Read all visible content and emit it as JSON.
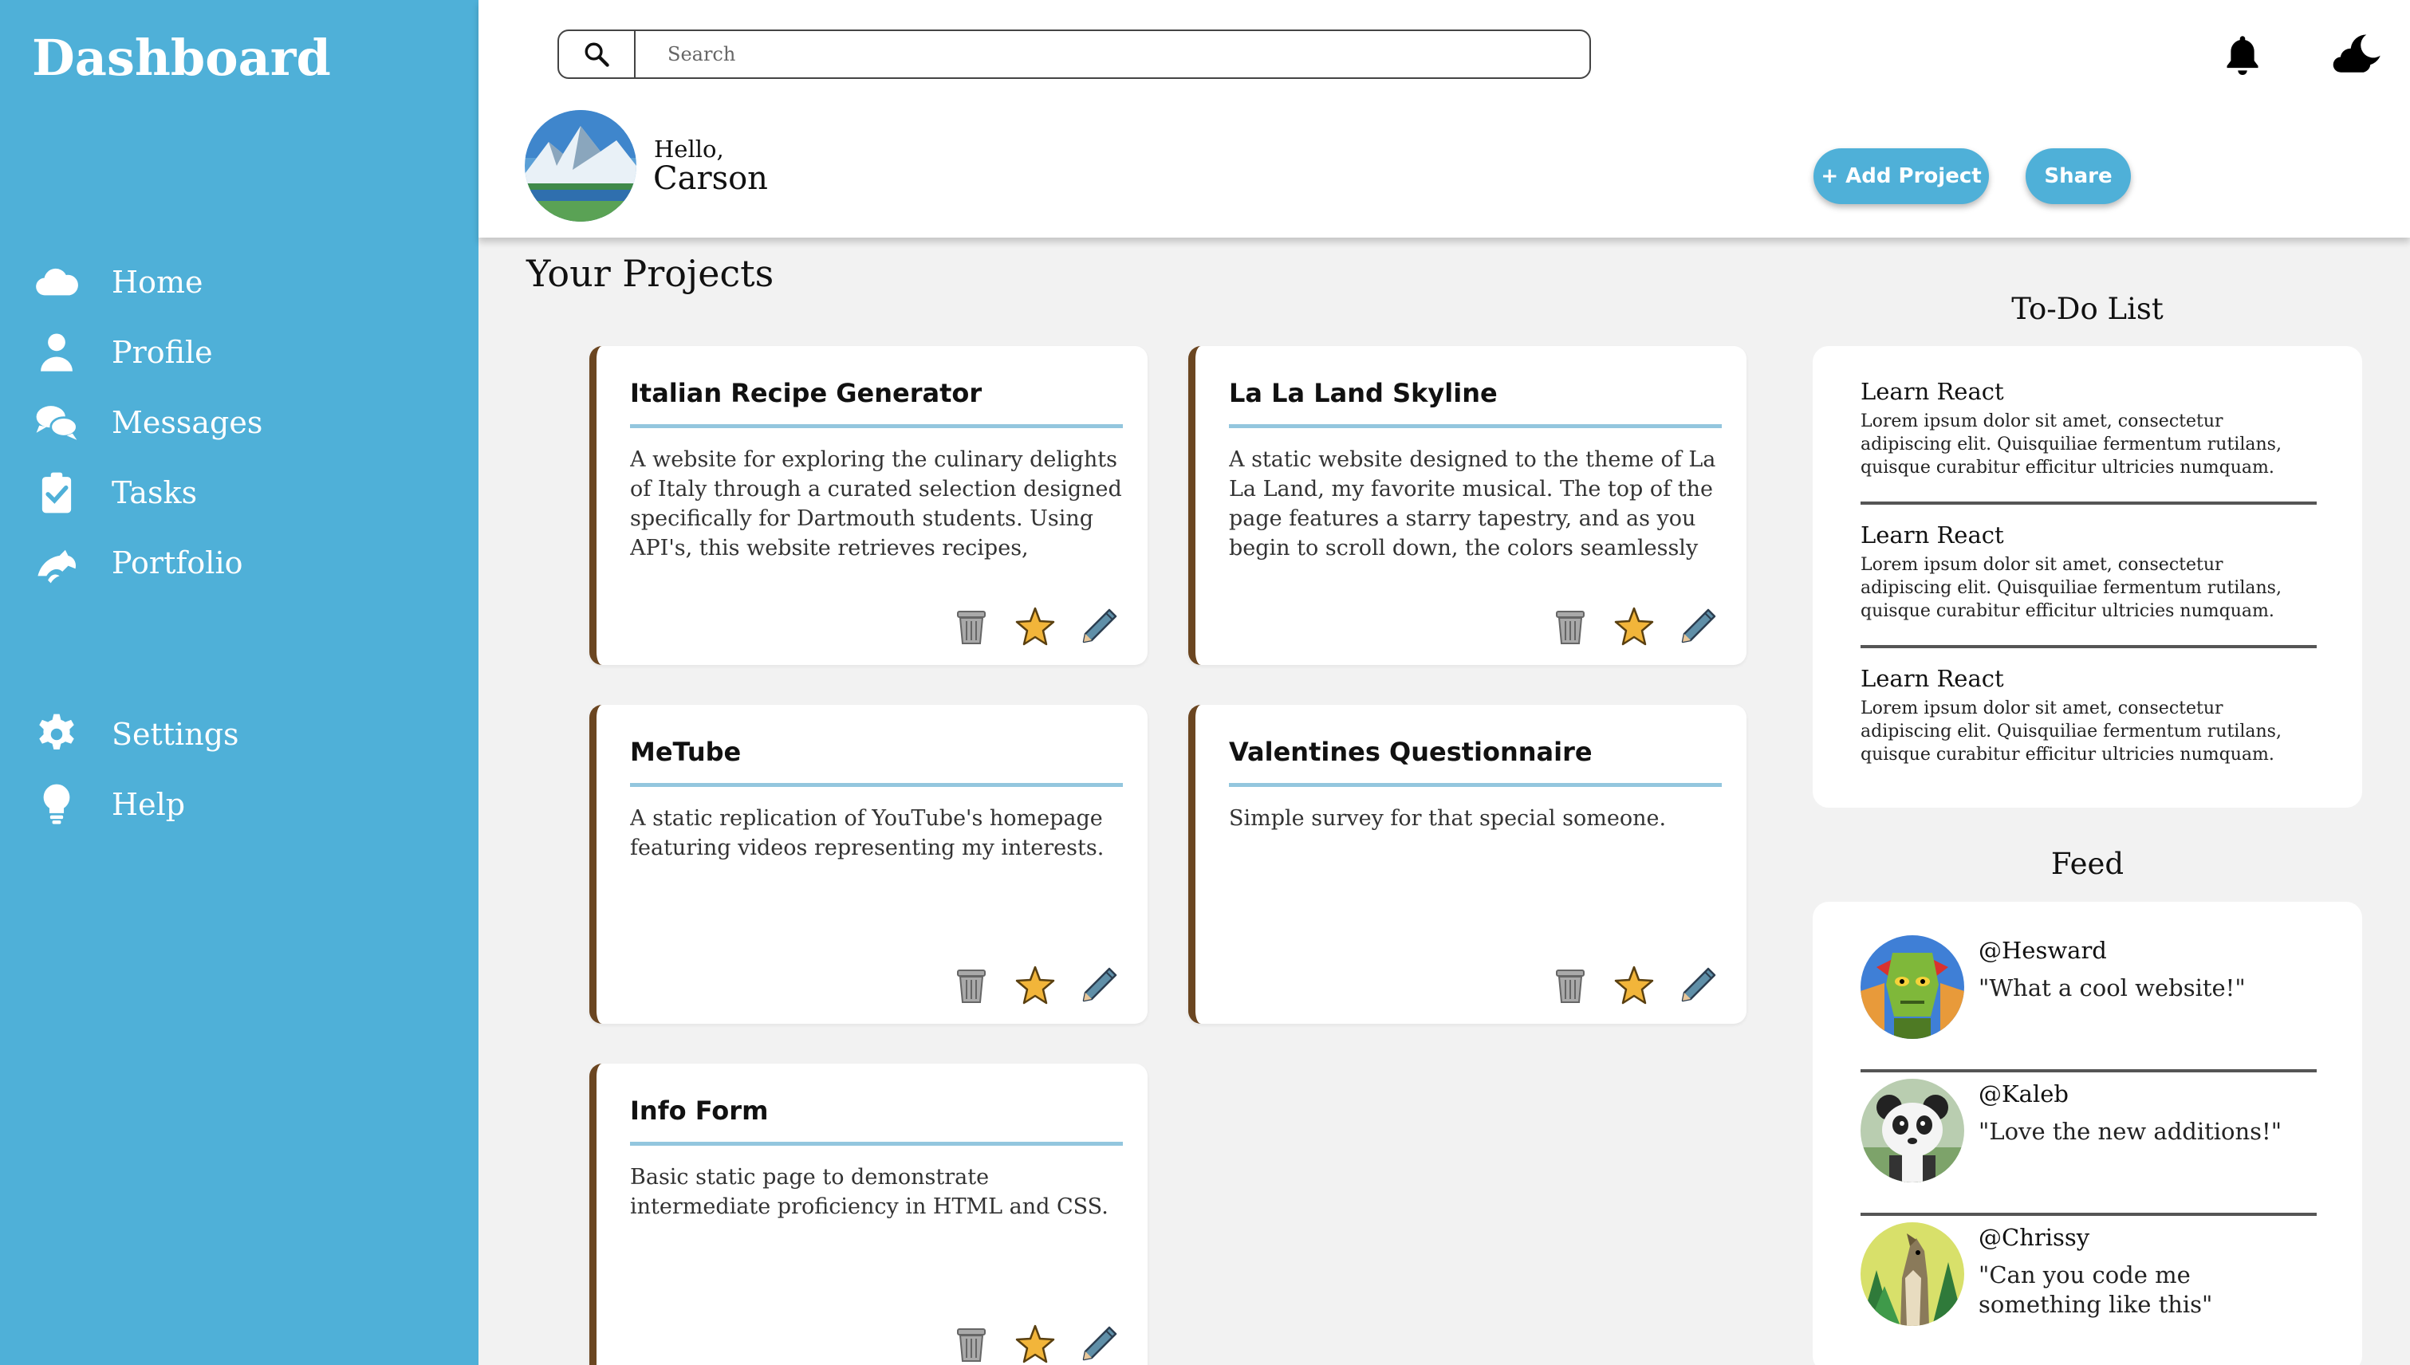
{
  "sidebar": {
    "title": "Dashboard",
    "nav_top": [
      {
        "label": "Home",
        "icon": "cloud-icon"
      },
      {
        "label": "Profile",
        "icon": "user-icon"
      },
      {
        "label": "Messages",
        "icon": "chat-icon"
      },
      {
        "label": "Tasks",
        "icon": "clipboard-check-icon"
      },
      {
        "label": "Portfolio",
        "icon": "dragon-icon"
      }
    ],
    "nav_bottom": [
      {
        "label": "Settings",
        "icon": "gear-icon"
      },
      {
        "label": "Help",
        "icon": "lightbulb-icon"
      }
    ]
  },
  "header": {
    "search_placeholder": "Search",
    "greeting": "Hello,",
    "username": "Carson",
    "add_project_label": "+ Add Project",
    "share_label": "Share"
  },
  "projects": {
    "title": "Your Projects",
    "items": [
      {
        "title": "Italian Recipe Generator",
        "description": "A website for exploring the culinary delights of Italy through a curated selection designed specifically for Dartmouth students. Using API's, this website retrieves recipes, restaurants, and reviews"
      },
      {
        "title": "La La Land Skyline",
        "description": "A static website designed to the theme of La La Land, my favorite musical. The top of the page features a starry tapestry, and as you begin to scroll down, the colors seamlessly transition, gently softening into a palette of muted blues"
      },
      {
        "title": "MeTube",
        "description": "A static replication of YouTube's homepage featuring videos representing my interests."
      },
      {
        "title": "Valentines Questionnaire",
        "description": "Simple survey for that special someone."
      },
      {
        "title": "Info Form",
        "description": "Basic static page to demonstrate intermediate proficiency in HTML and CSS."
      }
    ]
  },
  "todo": {
    "title": "To-Do List",
    "items": [
      {
        "title": "Learn React",
        "description": "Lorem ipsum dolor sit amet, consectetur adipiscing elit. Quisquiliae fermentum rutilans, quisque curabitur efficitur ultricies numquam."
      },
      {
        "title": "Learn React",
        "description": "Lorem ipsum dolor sit amet, consectetur adipiscing elit. Quisquiliae fermentum rutilans, quisque curabitur efficitur ultricies numquam."
      },
      {
        "title": "Learn React",
        "description": "Lorem ipsum dolor sit amet, consectetur adipiscing elit. Quisquiliae fermentum rutilans, quisque curabitur efficitur ultricies numquam."
      }
    ]
  },
  "feed": {
    "title": "Feed",
    "items": [
      {
        "user": "@Hesward",
        "message": "\"What a cool website!\""
      },
      {
        "user": "@Kaleb",
        "message": "\"Love the new additions!\""
      },
      {
        "user": "@Chrissy",
        "message": "\"Can you code me something like this\""
      }
    ]
  },
  "colors": {
    "accent": "#4fb0d8",
    "card_border": "#6b4621",
    "card_rule": "#93c6de",
    "background": "#f2f2f2"
  }
}
